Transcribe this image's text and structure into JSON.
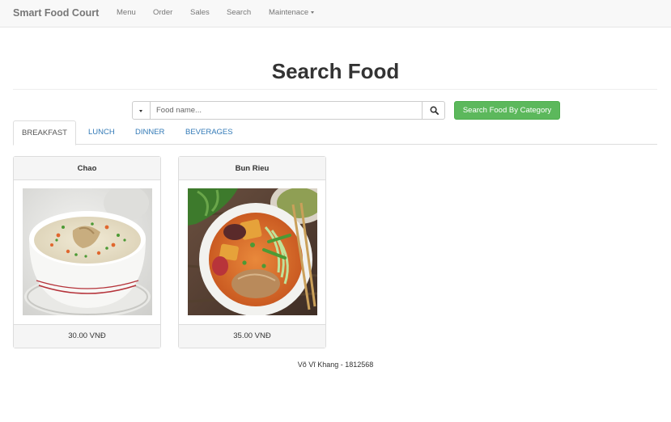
{
  "navbar": {
    "brand": "Smart Food Court",
    "links": [
      "Menu",
      "Order",
      "Sales",
      "Search",
      "Maintenace"
    ]
  },
  "page": {
    "title": "Search Food"
  },
  "search": {
    "placeholder": "Food name...",
    "category_button": "Search Food By Category"
  },
  "tabs": [
    "BREAKFAST",
    "LUNCH",
    "DINNER",
    "BEVERAGES"
  ],
  "foods": [
    {
      "name": "Chao",
      "price": "30.00 VNĐ"
    },
    {
      "name": "Bun Rieu",
      "price": "35.00 VNĐ"
    }
  ],
  "footer": {
    "text": "Võ Vĩ Khang - 1812568"
  },
  "colors": {
    "accent": "#337ab7",
    "success": "#5cb85c",
    "navbar": "#f8f8f8"
  }
}
